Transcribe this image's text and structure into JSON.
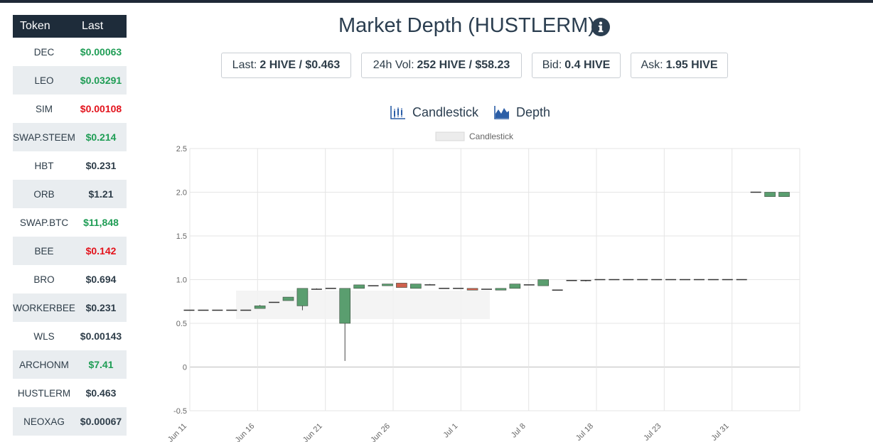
{
  "token_table": {
    "header": {
      "token": "Token",
      "last": "Last"
    },
    "rows": [
      {
        "name": "DEC",
        "price": "$0.00063",
        "color": "green"
      },
      {
        "name": "LEO",
        "price": "$0.03291",
        "color": "green"
      },
      {
        "name": "SIM",
        "price": "$0.00108",
        "color": "red"
      },
      {
        "name": "SWAP.STEEM",
        "price": "$0.214",
        "color": "green"
      },
      {
        "name": "HBT",
        "price": "$0.231",
        "color": "dark"
      },
      {
        "name": "ORB",
        "price": "$1.21",
        "color": "dark"
      },
      {
        "name": "SWAP.BTC",
        "price": "$11,848",
        "color": "green"
      },
      {
        "name": "BEE",
        "price": "$0.142",
        "color": "red"
      },
      {
        "name": "BRO",
        "price": "$0.694",
        "color": "dark"
      },
      {
        "name": "WORKERBEE",
        "price": "$0.231",
        "color": "dark"
      },
      {
        "name": "WLS",
        "price": "$0.00143",
        "color": "dark"
      },
      {
        "name": "ARCHONM",
        "price": "$7.41",
        "color": "green"
      },
      {
        "name": "HUSTLERM",
        "price": "$0.463",
        "color": "dark"
      },
      {
        "name": "NEOXAG",
        "price": "$0.00067",
        "color": "dark"
      }
    ]
  },
  "header": {
    "title": "Market Depth (HUSTLERM)",
    "info_icon": "info-circle-icon"
  },
  "stats": {
    "last_label": "Last:",
    "last_value": "2 HIVE / $0.463",
    "vol_label": "24h Vol:",
    "vol_value": "252 HIVE / $58.23",
    "bid_label": "Bid:",
    "bid_value": "0.4 HIVE",
    "ask_label": "Ask:",
    "ask_value": "1.95 HIVE"
  },
  "tabs": {
    "candlestick": "Candlestick",
    "depth": "Depth"
  },
  "colors": {
    "up": "#5a9e6f",
    "down": "#d0604d",
    "green_text": "#1f9d55",
    "red_text": "#e3131c",
    "header_bg": "#1e2c3a"
  },
  "chart_data": {
    "type": "candlestick",
    "legend": "Candlestick",
    "ylim": [
      -0.5,
      2.5
    ],
    "y_ticks": [
      "2.5",
      "2.0",
      "1.5",
      "1.0",
      "0.5",
      "0",
      "-0.5"
    ],
    "x_ticks": [
      "Jun 11",
      "Jun 16",
      "Jun 21",
      "Jun 26",
      "Jul 1",
      "Jul 8",
      "Jul 18",
      "Jul 23",
      "Jul 31"
    ],
    "candles": [
      {
        "o": 0.65,
        "h": 0.65,
        "l": 0.65,
        "c": 0.65
      },
      {
        "o": 0.65,
        "h": 0.65,
        "l": 0.65,
        "c": 0.65
      },
      {
        "o": 0.65,
        "h": 0.65,
        "l": 0.65,
        "c": 0.65
      },
      {
        "o": 0.65,
        "h": 0.65,
        "l": 0.65,
        "c": 0.65
      },
      {
        "o": 0.65,
        "h": 0.65,
        "l": 0.65,
        "c": 0.65
      },
      {
        "o": 0.67,
        "h": 0.71,
        "l": 0.67,
        "c": 0.7
      },
      {
        "o": 0.74,
        "h": 0.74,
        "l": 0.74,
        "c": 0.74
      },
      {
        "o": 0.76,
        "h": 0.8,
        "l": 0.76,
        "c": 0.8
      },
      {
        "o": 0.7,
        "h": 0.9,
        "l": 0.65,
        "c": 0.9
      },
      {
        "o": 0.89,
        "h": 0.9,
        "l": 0.89,
        "c": 0.89
      },
      {
        "o": 0.9,
        "h": 0.9,
        "l": 0.9,
        "c": 0.9
      },
      {
        "o": 0.5,
        "h": 0.9,
        "l": 0.07,
        "c": 0.9
      },
      {
        "o": 0.9,
        "h": 0.94,
        "l": 0.9,
        "c": 0.94
      },
      {
        "o": 0.93,
        "h": 0.93,
        "l": 0.93,
        "c": 0.93
      },
      {
        "o": 0.93,
        "h": 0.95,
        "l": 0.93,
        "c": 0.95
      },
      {
        "o": 0.96,
        "h": 0.96,
        "l": 0.91,
        "c": 0.91
      },
      {
        "o": 0.9,
        "h": 0.95,
        "l": 0.9,
        "c": 0.95
      },
      {
        "o": 0.94,
        "h": 0.95,
        "l": 0.94,
        "c": 0.94
      },
      {
        "o": 0.9,
        "h": 0.9,
        "l": 0.9,
        "c": 0.9
      },
      {
        "o": 0.9,
        "h": 0.9,
        "l": 0.9,
        "c": 0.9
      },
      {
        "o": 0.9,
        "h": 0.9,
        "l": 0.88,
        "c": 0.88
      },
      {
        "o": 0.89,
        "h": 0.89,
        "l": 0.89,
        "c": 0.89
      },
      {
        "o": 0.88,
        "h": 0.9,
        "l": 0.88,
        "c": 0.9
      },
      {
        "o": 0.9,
        "h": 0.95,
        "l": 0.9,
        "c": 0.95
      },
      {
        "o": 0.94,
        "h": 0.94,
        "l": 0.94,
        "c": 0.94
      },
      {
        "o": 0.93,
        "h": 1.0,
        "l": 0.93,
        "c": 1.0
      },
      {
        "o": 0.88,
        "h": 0.88,
        "l": 0.88,
        "c": 0.88
      },
      {
        "o": 0.99,
        "h": 0.99,
        "l": 0.99,
        "c": 0.99
      },
      {
        "o": 0.99,
        "h": 0.99,
        "l": 0.98,
        "c": 0.99
      },
      {
        "o": 1.0,
        "h": 1.0,
        "l": 1.0,
        "c": 1.0
      },
      {
        "o": 1.0,
        "h": 1.0,
        "l": 1.0,
        "c": 1.0
      },
      {
        "o": 1.0,
        "h": 1.0,
        "l": 1.0,
        "c": 1.0
      },
      {
        "o": 1.0,
        "h": 1.0,
        "l": 1.0,
        "c": 1.0
      },
      {
        "o": 1.0,
        "h": 1.0,
        "l": 1.0,
        "c": 1.0
      },
      {
        "o": 1.0,
        "h": 1.0,
        "l": 1.0,
        "c": 1.0
      },
      {
        "o": 1.0,
        "h": 1.0,
        "l": 1.0,
        "c": 1.0
      },
      {
        "o": 1.0,
        "h": 1.0,
        "l": 1.0,
        "c": 1.0
      },
      {
        "o": 1.0,
        "h": 1.0,
        "l": 1.0,
        "c": 1.0
      },
      {
        "o": 1.0,
        "h": 1.0,
        "l": 1.0,
        "c": 1.0
      },
      {
        "o": 1.0,
        "h": 1.0,
        "l": 1.0,
        "c": 1.0
      },
      {
        "o": 2.0,
        "h": 2.0,
        "l": 2.0,
        "c": 2.0
      },
      {
        "o": 1.95,
        "h": 2.0,
        "l": 1.95,
        "c": 2.0
      },
      {
        "o": 1.95,
        "h": 2.0,
        "l": 1.95,
        "c": 2.0
      }
    ]
  }
}
